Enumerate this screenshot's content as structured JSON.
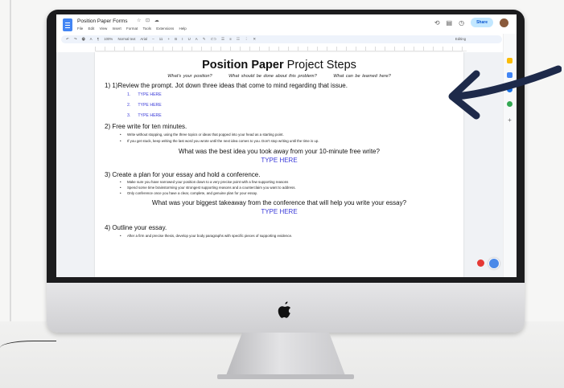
{
  "window": {
    "doc_title": "Position Paper Forms",
    "title_icons": "☆ ⊡ ☁",
    "menus": [
      "File",
      "Edit",
      "View",
      "Insert",
      "Format",
      "Tools",
      "Extensions",
      "Help"
    ],
    "share_label": "Share",
    "editing_label": "Editing"
  },
  "toolbar": {
    "items": [
      "↶",
      "↷",
      "🖶",
      "A",
      "¶",
      "100%",
      "Normal text",
      "Arial",
      "–",
      "11",
      "+",
      "B",
      "I",
      "U",
      "A",
      "✎",
      "⊂⊃",
      "☰",
      "≡",
      "☷",
      "⋮",
      "✕"
    ]
  },
  "document": {
    "title_bold": "Position Paper",
    "title_rest": " Project Steps",
    "questions": [
      "What's your position?",
      "What should be done about this problem?",
      "What can be learned here?"
    ],
    "step1": {
      "heading": "1) 1)Review the prompt. Jot down three ideas that come to mind regarding that issue.",
      "items": [
        {
          "num": "1.",
          "text": "TYPE HERE"
        },
        {
          "num": "2.",
          "text": "TYPE HERE"
        },
        {
          "num": "3.",
          "text": "TYPE HERE"
        }
      ]
    },
    "step2": {
      "heading": "2) Free write for ten minutes.",
      "bullets": [
        "Write without stopping, using the three topics or ideas that popped into your head as a starting point.",
        "If you get stuck, keep writing the last word you wrote until the next idea comes to you. Don't stop writing until the time is up."
      ],
      "question": "What was the best idea you took away from your 10-minute free write?",
      "answer": "TYPE HERE"
    },
    "step3": {
      "heading": "3) Create a plan for your essay and hold a conference.",
      "bullets": [
        "Make sure you have narrowed your position down to a very precise point with a few supporting reasons",
        "Spend some time brainstorming your strongest supporting reasons and a counterclaim you want to address.",
        "Only conference once you have a clear, complete, and genuine plan for your essay."
      ],
      "question": "What was your biggest takeaway from the conference that will help you write your essay?",
      "answer": "TYPE HERE"
    },
    "step4": {
      "heading": "4) Outline your essay.",
      "bullets": [
        "After a firm and precise thesis, develop your body paragraphs with specific pieces of supporting evidence."
      ]
    }
  },
  "colors": {
    "type_here_blue": "#3b3bd9",
    "arrow_navy": "#1e2a4a",
    "share_bg": "#c2e7ff"
  }
}
